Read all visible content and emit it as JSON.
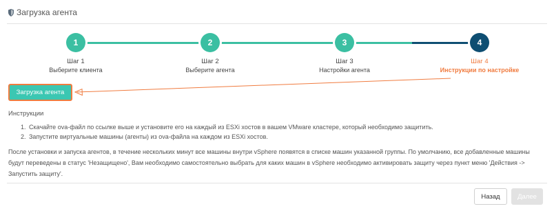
{
  "header": {
    "title": "Загрузка агента",
    "icon": "shield-icon"
  },
  "colors": {
    "done": "#3bbfa2",
    "active": "#0e4e72",
    "highlight": "#f07b3f",
    "button": "#3bc7b2"
  },
  "stepper": {
    "steps": [
      {
        "number": "1",
        "title": "Шаг 1",
        "subtitle": "Выберите клиента",
        "state": "done"
      },
      {
        "number": "2",
        "title": "Шаг 2",
        "subtitle": "Выберите агента",
        "state": "done"
      },
      {
        "number": "3",
        "title": "Шаг 3",
        "subtitle": "Настройки агента",
        "state": "done"
      },
      {
        "number": "4",
        "title": "Шаг 4",
        "subtitle": "Инструкции по настройке",
        "state": "current"
      }
    ]
  },
  "download_button": "Загрузка агента",
  "instructions": {
    "title": "Инструкции",
    "items": [
      {
        "num": "1.",
        "text": "Скачайте ova-файл по ссылке выше и установите его на каждый из ESXi хостов в вашем VMware кластере, который необходимо защитить."
      },
      {
        "num": "2.",
        "text": "Запустите виртуальные машины (агенты) из ova-файла на каждом из ESXi хостов."
      }
    ]
  },
  "note": "После установки и запуска агентов, в течение нескольких минут все машины внутри vSphere появятся в списке машин указанной группы. По умолчанию, все добавленные машины будут переведены в статус 'Незащищено', Вам необходимо самостоятельно выбрать для каких машин в vSphere необходимо активировать защиту через пункт меню 'Действия -> Запустить защиту'.",
  "footer": {
    "back_label": "Назад",
    "next_label": "Далее"
  }
}
